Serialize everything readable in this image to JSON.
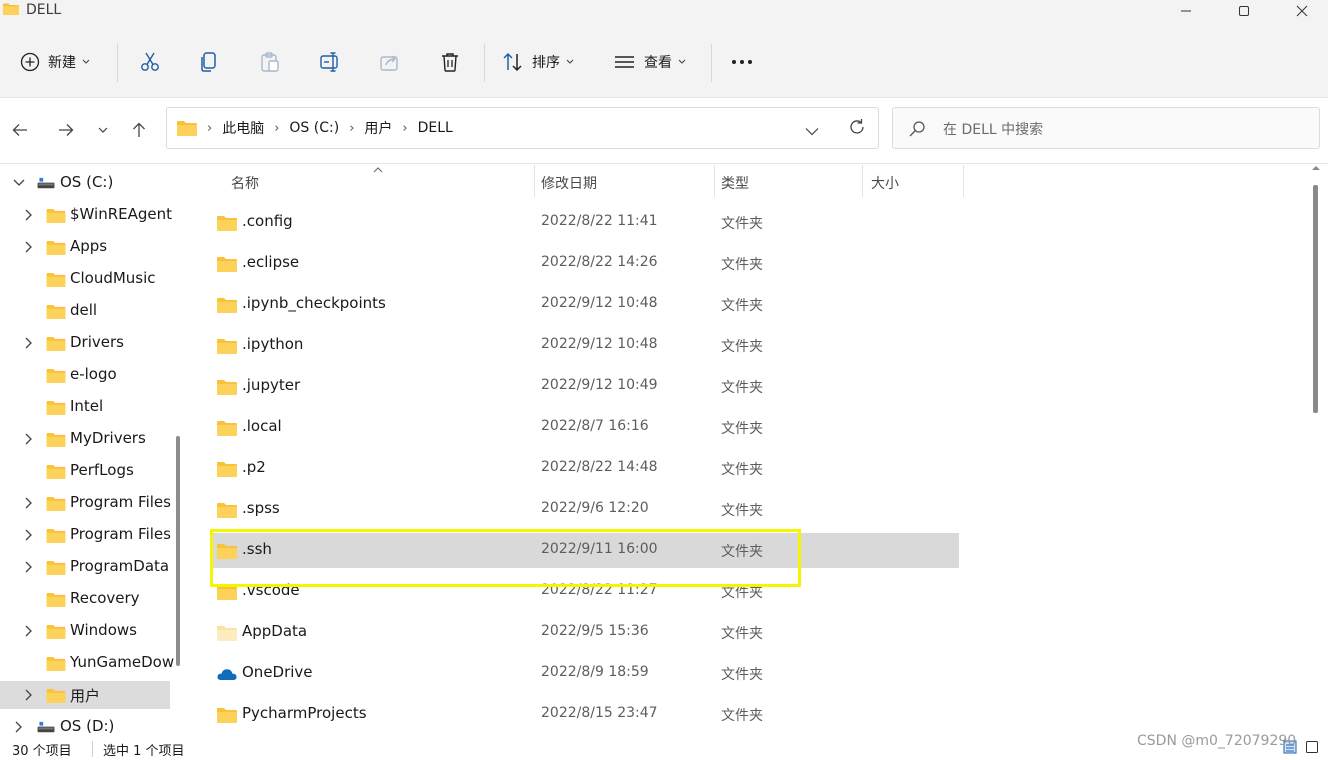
{
  "window": {
    "title": "DELL"
  },
  "toolbar": {
    "new_label": "新建",
    "sort_label": "排序",
    "view_label": "查看",
    "more_label": "···"
  },
  "address": {
    "crumbs": [
      "此电脑",
      "OS (C:)",
      "用户",
      "DELL"
    ],
    "search_placeholder": "在 DELL 中搜索"
  },
  "sidebar": {
    "items": [
      {
        "label": "OS (C:)",
        "icon": "drive-icon",
        "expand": "expanded"
      },
      {
        "label": "$WinREAgent",
        "icon": "folder-icon",
        "expand": "collapsed"
      },
      {
        "label": "Apps",
        "icon": "folder-icon",
        "expand": "collapsed"
      },
      {
        "label": "CloudMusic",
        "icon": "folder-icon",
        "expand": "none"
      },
      {
        "label": "dell",
        "icon": "folder-icon",
        "expand": "none"
      },
      {
        "label": "Drivers",
        "icon": "folder-icon",
        "expand": "collapsed"
      },
      {
        "label": "e-logo",
        "icon": "folder-icon",
        "expand": "none"
      },
      {
        "label": "Intel",
        "icon": "folder-icon",
        "expand": "none"
      },
      {
        "label": "MyDrivers",
        "icon": "folder-icon",
        "expand": "collapsed"
      },
      {
        "label": "PerfLogs",
        "icon": "folder-icon",
        "expand": "none"
      },
      {
        "label": "Program Files",
        "icon": "folder-icon",
        "expand": "collapsed"
      },
      {
        "label": "Program Files",
        "icon": "folder-icon",
        "expand": "collapsed"
      },
      {
        "label": "ProgramData",
        "icon": "folder-icon",
        "expand": "collapsed"
      },
      {
        "label": "Recovery",
        "icon": "folder-icon",
        "expand": "none"
      },
      {
        "label": "Windows",
        "icon": "folder-icon",
        "expand": "collapsed"
      },
      {
        "label": "YunGameDow",
        "icon": "folder-icon",
        "expand": "none"
      },
      {
        "label": "用户",
        "icon": "folder-icon",
        "expand": "collapsed",
        "selected": true
      },
      {
        "label": "OS (D:)",
        "icon": "drive-icon",
        "expand": "collapsed"
      }
    ]
  },
  "list": {
    "columns": {
      "name": "名称",
      "date": "修改日期",
      "type": "类型",
      "size": "大小"
    },
    "rows": [
      {
        "name": ".config",
        "date": "2022/8/22 11:41",
        "type": "文件夹",
        "icon": "folder-icon"
      },
      {
        "name": ".eclipse",
        "date": "2022/8/22 14:26",
        "type": "文件夹",
        "icon": "folder-icon"
      },
      {
        "name": ".ipynb_checkpoints",
        "date": "2022/9/12 10:48",
        "type": "文件夹",
        "icon": "folder-icon"
      },
      {
        "name": ".ipython",
        "date": "2022/9/12 10:48",
        "type": "文件夹",
        "icon": "folder-icon"
      },
      {
        "name": ".jupyter",
        "date": "2022/9/12 10:49",
        "type": "文件夹",
        "icon": "folder-icon"
      },
      {
        "name": ".local",
        "date": "2022/8/7 16:16",
        "type": "文件夹",
        "icon": "folder-icon"
      },
      {
        "name": ".p2",
        "date": "2022/8/22 14:48",
        "type": "文件夹",
        "icon": "folder-icon"
      },
      {
        "name": ".spss",
        "date": "2022/9/6 12:20",
        "type": "文件夹",
        "icon": "folder-icon"
      },
      {
        "name": ".ssh",
        "date": "2022/9/11 16:00",
        "type": "文件夹",
        "icon": "folder-icon",
        "selected": true
      },
      {
        "name": ".vscode",
        "date": "2022/8/22 11:27",
        "type": "文件夹",
        "icon": "folder-icon"
      },
      {
        "name": "AppData",
        "date": "2022/9/5 15:36",
        "type": "文件夹",
        "icon": "folder-light-icon"
      },
      {
        "name": "OneDrive",
        "date": "2022/8/9 18:59",
        "type": "文件夹",
        "icon": "cloud-icon"
      },
      {
        "name": "PycharmProjects",
        "date": "2022/8/15 23:47",
        "type": "文件夹",
        "icon": "folder-icon"
      }
    ]
  },
  "status": {
    "count": "30 个项目",
    "selection": "选中 1 个项目"
  },
  "watermark": "CSDN @m0_72079290",
  "colors": {
    "folder": "#f8c33a",
    "selection": "#d9d9d9",
    "highlight_box": "#f5f500",
    "onedrive": "#0f6cbd"
  }
}
